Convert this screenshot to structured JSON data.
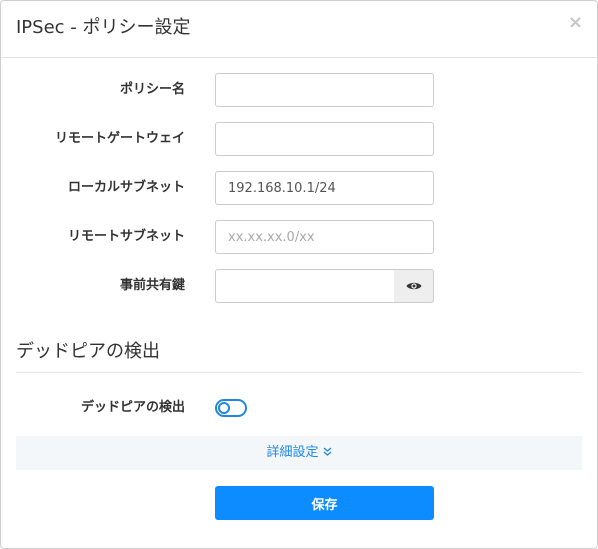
{
  "dialog": {
    "title": "IPSec - ポリシー設定",
    "close_icon": "close-icon",
    "close_glyph": "×"
  },
  "form": {
    "policy_name": {
      "label": "ポリシー名",
      "value": "",
      "placeholder": ""
    },
    "remote_gateway": {
      "label": "リモートゲートウェイ",
      "value": "",
      "placeholder": ""
    },
    "local_subnet": {
      "label": "ローカルサブネット",
      "value": "192.168.10.1/24",
      "placeholder": ""
    },
    "remote_subnet": {
      "label": "リモートサブネット",
      "value": "",
      "placeholder": "xx.xx.xx.0/xx"
    },
    "preshared_key": {
      "label": "事前共有鍵",
      "value": "",
      "placeholder": "",
      "toggle_visibility_icon": "eye-icon"
    }
  },
  "dpd_section": {
    "title": "デッドピアの検出",
    "toggle_label": "デッドピアの検出",
    "toggle_state": "off"
  },
  "advanced": {
    "label": "詳細設定",
    "icon": "double-chevron-down-icon",
    "glyph": "»"
  },
  "actions": {
    "save_label": "保存"
  },
  "colors": {
    "accent": "#0d8cff",
    "link": "#1e88e5",
    "advanced_bg": "#f3f7f9"
  }
}
